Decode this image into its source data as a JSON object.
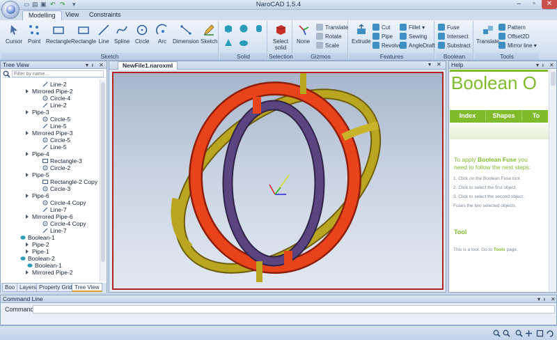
{
  "window": {
    "title": "NaroCAD 1.5.4",
    "minimize": "–",
    "maximize": "▫",
    "close": "✕"
  },
  "qat": {
    "new": "▭",
    "open": "▤",
    "save": "▣",
    "undo": "↶",
    "redo": "↷",
    "more": "▾"
  },
  "tabs": [
    {
      "label": "Modelling",
      "active": true
    },
    {
      "label": "View"
    },
    {
      "label": "Constraints"
    }
  ],
  "ribbon": {
    "sketch": {
      "label": "Sketch",
      "buttons": [
        "Cursor",
        "Point",
        "Rectangle",
        "Rectangle",
        "Line",
        "Spline",
        "Circle",
        "Arc",
        "Dimension",
        "Sketch"
      ]
    },
    "solid": {
      "label": "Solid"
    },
    "selection": {
      "label": "Selection",
      "button": "Select solid"
    },
    "gizmos": {
      "label": "Gizmos",
      "none": "None",
      "translate": "Translate",
      "rotate": "Rotate",
      "scale": "Scale"
    },
    "features": {
      "label": "Features",
      "extrude": "Extrude",
      "cut": "Cut",
      "pipe": "Pipe",
      "revolve": "Revolve",
      "fillet": "Fillet",
      "sewing": "Sewing",
      "angledraft": "AngleDraft"
    },
    "boolean": {
      "label": "Boolean",
      "fuse": "Fuse",
      "intersect": "Intersect",
      "substract": "Substract"
    },
    "tools": {
      "label": "Tools",
      "translate": "Translate",
      "pattern": "Pattern",
      "offset2d": "Offset2D",
      "mirror": "Mirror line"
    }
  },
  "tree_view": {
    "title": "Tree View",
    "filter_placeholder": "Filter by name...",
    "rows": [
      {
        "label": "Line-2",
        "icon": "line",
        "depth": 2
      },
      {
        "label": "Mirrored Pipe-2",
        "icon": "node",
        "depth": 1
      },
      {
        "label": "Circle-4",
        "icon": "circle",
        "depth": 2
      },
      {
        "label": "Line-2",
        "icon": "line",
        "depth": 2
      },
      {
        "label": "Pipe-3",
        "icon": "node",
        "depth": 1
      },
      {
        "label": "Circle-5",
        "icon": "circle",
        "depth": 2
      },
      {
        "label": "Line-5",
        "icon": "line",
        "depth": 2
      },
      {
        "label": "Mirrored Pipe-3",
        "icon": "node",
        "depth": 1
      },
      {
        "label": "Circle-5",
        "icon": "circle",
        "depth": 2
      },
      {
        "label": "Line-5",
        "icon": "line",
        "depth": 2
      },
      {
        "label": "Pipe-4",
        "icon": "node",
        "depth": 1
      },
      {
        "label": "Rectangle-3",
        "icon": "rect",
        "depth": 2
      },
      {
        "label": "Circle-2",
        "icon": "circle",
        "depth": 2
      },
      {
        "label": "Pipe-5",
        "icon": "node",
        "depth": 1
      },
      {
        "label": "Rectangle-2 Copy",
        "icon": "rect",
        "depth": 2
      },
      {
        "label": "Circle-3",
        "icon": "circle",
        "depth": 2
      },
      {
        "label": "Pipe-6",
        "icon": "node",
        "depth": 1
      },
      {
        "label": "Circle-4 Copy",
        "icon": "circle",
        "depth": 2
      },
      {
        "label": "Line-7",
        "icon": "line",
        "depth": 2
      },
      {
        "label": "Mirrored Pipe-6",
        "icon": "node",
        "depth": 1
      },
      {
        "label": "Circle-4 Copy",
        "icon": "circle",
        "depth": 2
      },
      {
        "label": "Line-7",
        "icon": "line",
        "depth": 2
      },
      {
        "label": "Boolean-1",
        "icon": "solid",
        "depth": 0
      },
      {
        "label": "Pipe-2",
        "icon": "node",
        "depth": 1
      },
      {
        "label": "Pipe-1",
        "icon": "node",
        "depth": 1
      },
      {
        "label": "Boolean-2",
        "icon": "solid",
        "depth": 0
      },
      {
        "label": "Boolean-1",
        "icon": "solid",
        "depth": 1
      },
      {
        "label": "Mirrored Pipe-2",
        "icon": "node",
        "depth": 1
      }
    ],
    "bottom_tabs": [
      {
        "label": "Boo"
      },
      {
        "label": "Layers"
      },
      {
        "label": "Property Grid"
      },
      {
        "label": "Tree View",
        "active": true
      }
    ]
  },
  "document": {
    "tab": "NewFile1.naroxml",
    "ring_colors": {
      "red": "#e8431b",
      "gold": "#b8a620",
      "purple": "#5b4580"
    }
  },
  "help": {
    "title": "Help",
    "banner": "Boolean O",
    "nav": [
      "Index",
      "Shapes",
      "To"
    ],
    "intro_pre": "To apply ",
    "intro_bold": "Boolean Fuse",
    "intro_post": " you",
    "intro_line2": "need to follow the next steps:",
    "steps": [
      "1. Click on the Boolean Fuse tool.",
      "2. Click to select the first object.",
      "3. Click to select the second object.",
      "Fuses the two selected objects."
    ],
    "tool_heading": "Tool",
    "tool_text": "This is a tool. Go to ",
    "tool_link": "Tools",
    "tool_text_end": " page."
  },
  "command_line": {
    "title": "Command Line",
    "label": "Command:",
    "value": ""
  },
  "colors": {
    "accent": "#7fbb2b",
    "selection_border": "#b22222",
    "ribbon": "#d6e3f3"
  }
}
